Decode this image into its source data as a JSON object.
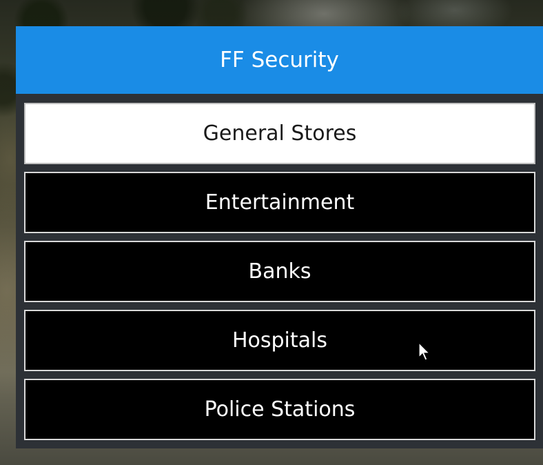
{
  "menu": {
    "title": "FF Security",
    "items": [
      {
        "label": "General Stores",
        "selected": true
      },
      {
        "label": "Entertainment",
        "selected": false
      },
      {
        "label": "Banks",
        "selected": false
      },
      {
        "label": "Hospitals",
        "selected": false
      },
      {
        "label": "Police Stations",
        "selected": false
      }
    ]
  },
  "colors": {
    "header": "#1a8ce6",
    "panel": "#2d3136",
    "item_bg": "#000000",
    "item_selected_bg": "#ffffff"
  },
  "cursor": {
    "icon": "mouse-pointer-icon"
  }
}
